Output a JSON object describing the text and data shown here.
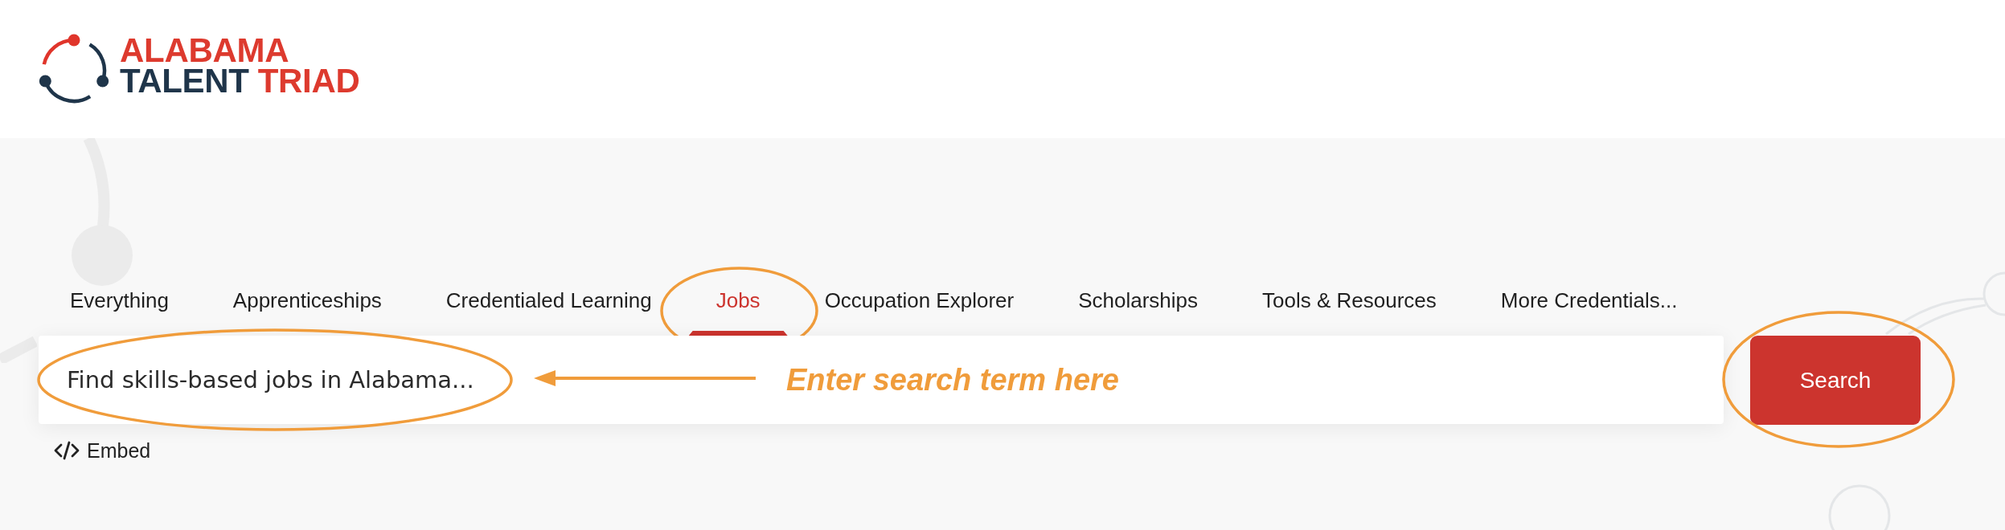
{
  "header": {
    "logo": {
      "lines": [
        {
          "words": [
            {
              "text": "ALABAMA",
              "color": "#dd3a2e"
            }
          ]
        },
        {
          "words": [
            {
              "text": "TALENT",
              "color": "#1f354a"
            },
            {
              "text": "TRIAD",
              "color": "#dd3a2e"
            }
          ]
        }
      ]
    }
  },
  "tabs": [
    {
      "label": "Everything",
      "selected": false,
      "highlighted": false
    },
    {
      "label": "Apprenticeships",
      "selected": false,
      "highlighted": false
    },
    {
      "label": "Credentialed Learning",
      "selected": false,
      "highlighted": false
    },
    {
      "label": "Jobs",
      "selected": true,
      "highlighted": true
    },
    {
      "label": "Occupation Explorer",
      "selected": false,
      "highlighted": false
    },
    {
      "label": "Scholarships",
      "selected": false,
      "highlighted": false
    },
    {
      "label": "Tools & Resources",
      "selected": false,
      "highlighted": false
    },
    {
      "label": "More Credentials...",
      "selected": false,
      "highlighted": false
    }
  ],
  "search": {
    "placeholder": "Find skills-based jobs in Alabama...",
    "highlighted": true,
    "button": {
      "label": "Search",
      "highlighted": true
    }
  },
  "embed": {
    "label": "Embed"
  },
  "annotation": {
    "text": "Enter search term here"
  }
}
